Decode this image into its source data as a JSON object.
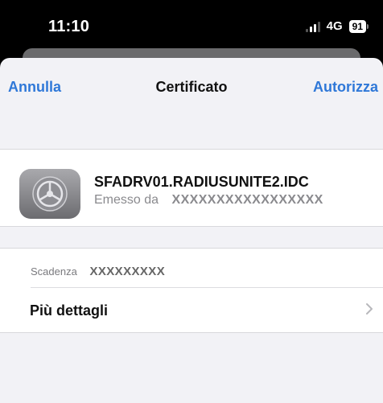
{
  "status_bar": {
    "time": "11:10",
    "network": "4G",
    "battery": "91"
  },
  "nav": {
    "cancel": "Annulla",
    "title": "Certificato",
    "authorize": "Autorizza"
  },
  "certificate": {
    "name": "SFADRV01.RADIUSUNITE2.IDC",
    "issued_by_label": "Emesso da",
    "issued_by_value": "XXXXXXXXXXXXXXXXX",
    "icon": "settings-gear-icon"
  },
  "details": {
    "expiry_label": "Scadenza",
    "expiry_value": "XXXXXXXXX",
    "more_details": "Più dettagli"
  },
  "colors": {
    "accent": "#2f78d8",
    "background": "#f2f2f6",
    "status_bar": "#000000"
  }
}
